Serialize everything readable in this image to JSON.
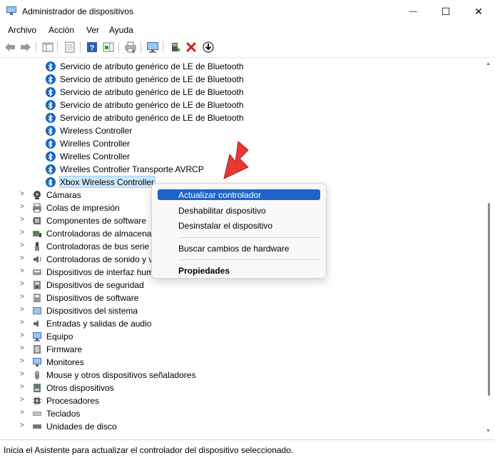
{
  "window": {
    "title": "Administrador de dispositivos",
    "minimize_glyph": "—",
    "maximize_glyph": "☐",
    "close_glyph": "✕"
  },
  "menu": [
    "Archivo",
    "Acción",
    "Ver",
    "Ayuda"
  ],
  "bluetooth_children": [
    "Servicio de atributo genérico de LE de Bluetooth",
    "Servicio de atributo genérico de LE de Bluetooth",
    "Servicio de atributo genérico de LE de Bluetooth",
    "Servicio de atributo genérico de LE de Bluetooth",
    "Servicio de atributo genérico de LE de Bluetooth",
    "Wireless Controller",
    "Wirelles Controller",
    "Wirelles Controller",
    "Wirelles Controller Transporte AVRCP",
    "Xbox Wireless Controller"
  ],
  "categories": [
    {
      "label": "Cámaras",
      "icon": "camera-icon"
    },
    {
      "label": "Colas de impresión",
      "icon": "printer-icon"
    },
    {
      "label": "Componentes de software",
      "icon": "software-component-icon"
    },
    {
      "label": "Controladoras de almacenamiento",
      "icon": "storage-controller-icon"
    },
    {
      "label": "Controladoras de bus serie universal",
      "icon": "usb-icon"
    },
    {
      "label": "Controladoras de sonido y vídeo y dispositivos de juego",
      "icon": "speaker-icon"
    },
    {
      "label": "Dispositivos de interfaz humana (HID)",
      "icon": "hid-icon"
    },
    {
      "label": "Dispositivos de seguridad",
      "icon": "security-device-icon"
    },
    {
      "label": "Dispositivos de software",
      "icon": "software-device-icon"
    },
    {
      "label": "Dispositivos del sistema",
      "icon": "system-device-icon"
    },
    {
      "label": "Entradas y salidas de audio",
      "icon": "audio-io-icon"
    },
    {
      "label": "Equipo",
      "icon": "computer-icon"
    },
    {
      "label": "Firmware",
      "icon": "firmware-icon"
    },
    {
      "label": "Monitores",
      "icon": "monitor-icon"
    },
    {
      "label": "Mouse y otros dispositivos señaladores",
      "icon": "mouse-icon"
    },
    {
      "label": "Otros dispositivos",
      "icon": "other-devices-icon"
    },
    {
      "label": "Procesadores",
      "icon": "processor-icon"
    },
    {
      "label": "Teclados",
      "icon": "keyboard-icon"
    },
    {
      "label": "Unidades de disco",
      "icon": "disk-drive-icon"
    }
  ],
  "context_menu": {
    "update_driver": "Actualizar controlador",
    "disable_device": "Deshabilitar dispositivo",
    "uninstall_device": "Desinstalar el dispositivo",
    "scan_hardware": "Buscar cambios de hardware",
    "properties": "Propiedades"
  },
  "status": "Inicia el Asistente para actualizar el controlador del dispositivo seleccionado.",
  "colors": {
    "bluetooth": "#1565c0",
    "highlight": "#1e64c8",
    "selection": "#cce8ff",
    "annotation_arrow": "#e53935"
  }
}
